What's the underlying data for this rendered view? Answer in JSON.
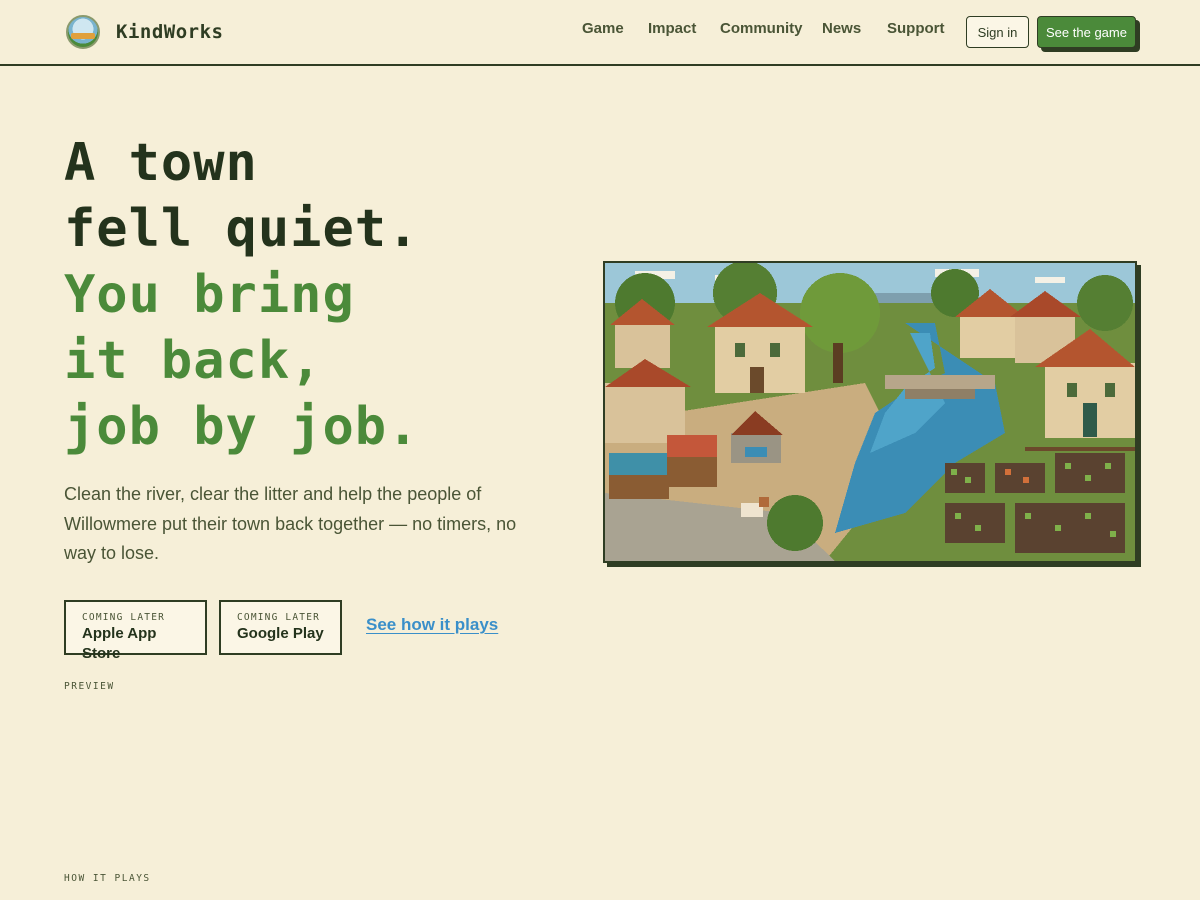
{
  "header": {
    "brand": "KindWorks",
    "nav": [
      "Game",
      "Impact",
      "Community",
      "News",
      "Support"
    ],
    "sign_in": "Sign in",
    "cta": "See the game"
  },
  "hero": {
    "headline_dark": [
      "A town",
      "fell quiet."
    ],
    "headline_green": [
      "You bring",
      "it back,",
      "job by job."
    ],
    "lead": "Clean the river, clear the litter and help the people of Willowmere put their town back together — no timers, no way to lose.",
    "stores": [
      {
        "kicker": "Coming later",
        "name": "Apple App Store"
      },
      {
        "kicker": "Coming later",
        "name": "Google Play"
      }
    ],
    "how_link": "See how it plays",
    "preview_tag": "Preview",
    "illustration_icon": "pixel-art-town-illustration"
  },
  "section_tag": "How it plays",
  "colors": {
    "background": "#f6efd8",
    "ink": "#2f3d23",
    "accent_green": "#4b8a3a",
    "link_blue": "#3a8fc9"
  }
}
